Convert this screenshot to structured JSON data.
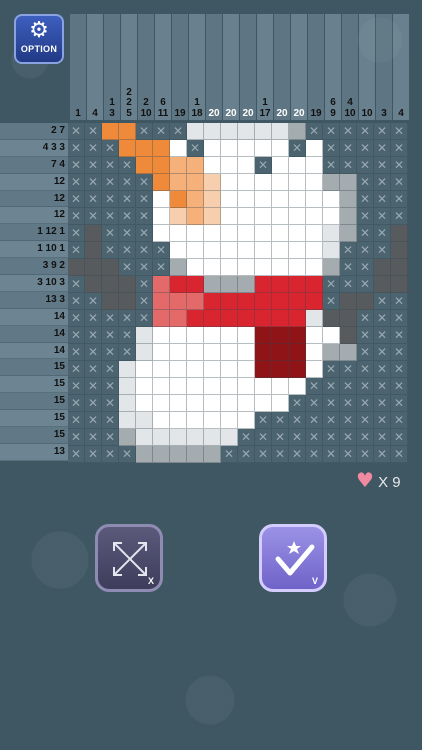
{
  "option_button": {
    "label": "OPTION",
    "icon": "gear-icon"
  },
  "column_clues": [
    [
      "1"
    ],
    [
      "4"
    ],
    [
      "1",
      "3"
    ],
    [
      "2",
      "2",
      "5"
    ],
    [
      "2",
      "10"
    ],
    [
      "6",
      "11"
    ],
    [
      "19"
    ],
    [
      "1",
      "18"
    ],
    [
      "20"
    ],
    [
      "20"
    ],
    [
      "20"
    ],
    [
      "1",
      "17"
    ],
    [
      "20"
    ],
    [
      "20"
    ],
    [
      "19"
    ],
    [
      "6",
      "9"
    ],
    [
      "4",
      "10"
    ],
    [
      "10"
    ],
    [
      "3"
    ],
    [
      "4"
    ]
  ],
  "row_clues": [
    "2 7",
    "4 3 3",
    "7 4",
    "12",
    "12",
    "12",
    "1 12 1",
    "1 10 1",
    "3 9 2",
    "3 10 3",
    "13 3",
    "14",
    "14",
    "14",
    "15",
    "15",
    "15",
    "15",
    "15",
    "13"
  ],
  "lives": {
    "icon": "heart-icon",
    "text": "X 9"
  },
  "mode_buttons": {
    "cross_tag": "X",
    "check_tag": "V"
  },
  "colors": {
    "orange": "#ee8a3a",
    "light_orange": "#f6b07a",
    "peach": "#f7cfae",
    "red": "#d9252f",
    "pink_red": "#e46a6a",
    "dark_red": "#8e1417",
    "white": "#ffffff",
    "light_gray": "#e3e6e8",
    "mid_gray": "#a5acb0",
    "dark_gray": "#575b5e",
    "empty": "#4b6470"
  }
}
